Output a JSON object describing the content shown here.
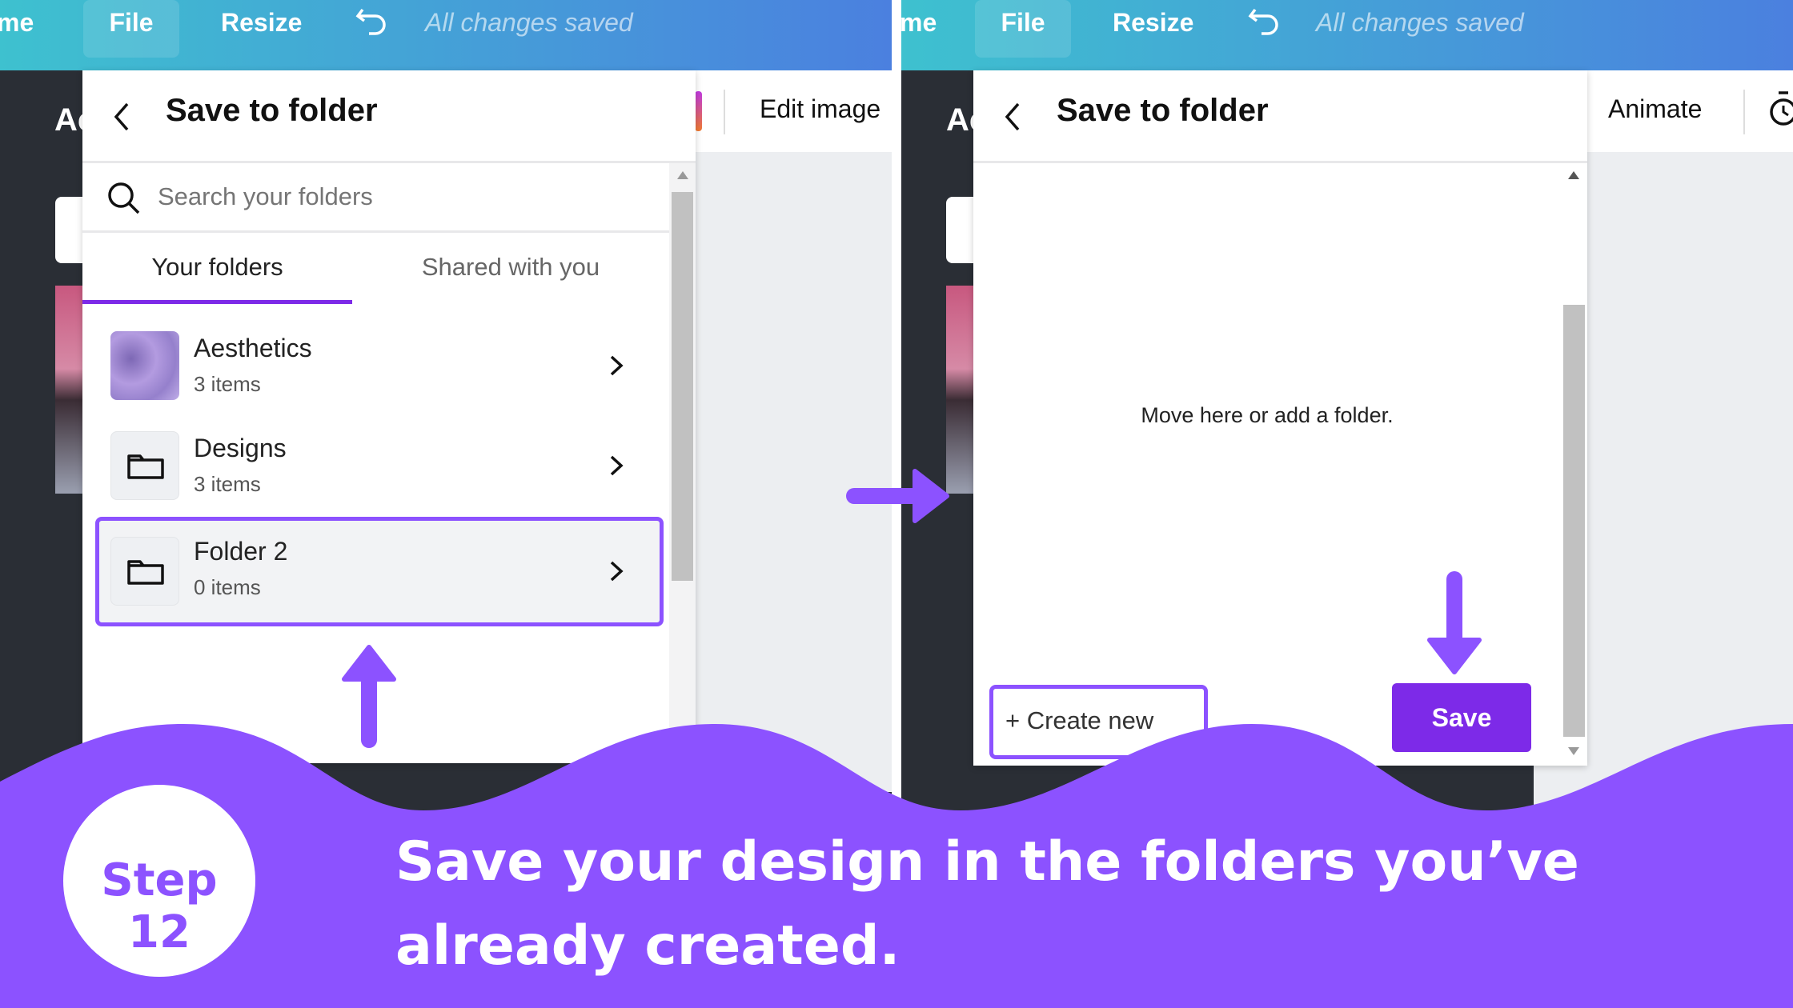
{
  "colors": {
    "accent": "#8c52ff",
    "save": "#7d2ae8",
    "topbar_start": "#3ec1cf",
    "topbar_end": "#4b80df"
  },
  "left": {
    "topbar": {
      "home": "me",
      "file": "File",
      "resize": "Resize",
      "undo_icon": "undo-icon",
      "status": "All changes saved"
    },
    "sidebar_label": "Ac",
    "toolbar": {
      "edit_image": "Edit image"
    },
    "dialog": {
      "title": "Save to folder",
      "search_placeholder": "Search your folders",
      "tabs": [
        {
          "label": "Your folders",
          "active": true
        },
        {
          "label": "Shared with you",
          "active": false
        }
      ],
      "folders": [
        {
          "name": "Aesthetics",
          "count": "3 items",
          "thumb": "image"
        },
        {
          "name": "Designs",
          "count": "3 items",
          "thumb": "folder-icon"
        },
        {
          "name": "Folder 2",
          "count": "0 items",
          "thumb": "folder-icon",
          "highlighted": true
        }
      ]
    }
  },
  "right": {
    "topbar": {
      "home": "me",
      "file": "File",
      "resize": "Resize",
      "status": "All changes saved"
    },
    "sidebar_label": "Ac",
    "toolbar": {
      "animate": "Animate",
      "timer_icon": "timer-icon"
    },
    "dialog": {
      "title": "Save to folder",
      "empty_text": "Move here or add a folder.",
      "create_new": "+ Create new",
      "save": "Save"
    }
  },
  "banner": {
    "step": "Step 12",
    "line1": "Save your design in the folders you’ve",
    "line2": "already created."
  }
}
